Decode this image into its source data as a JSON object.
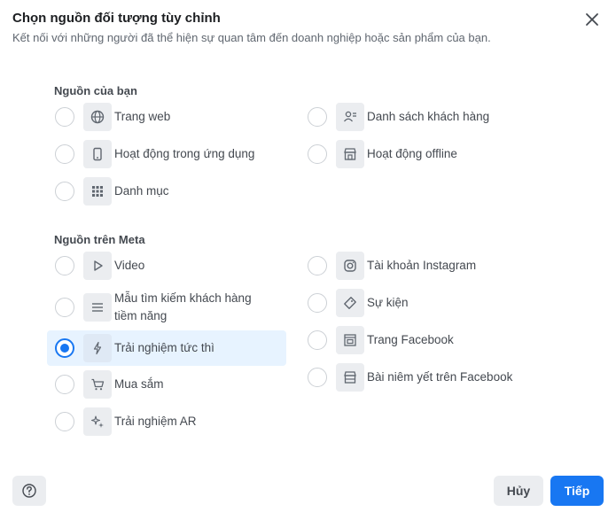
{
  "dialog": {
    "title": "Chọn nguồn đối tượng tùy chỉnh",
    "subtitle": "Kết nối với những người đã thể hiện sự quan tâm đến doanh nghiệp hoặc sản phẩm của bạn."
  },
  "your_sources": {
    "heading": "Nguồn của bạn",
    "options": [
      {
        "label": "Trang web",
        "icon": "globe-icon"
      },
      {
        "label": "Danh sách khách hàng",
        "icon": "customer-list-icon"
      },
      {
        "label": "Hoạt động trong ứng dụng",
        "icon": "mobile-app-icon"
      },
      {
        "label": "Hoạt động offline",
        "icon": "store-icon"
      },
      {
        "label": "Danh mục",
        "icon": "grid-icon"
      }
    ]
  },
  "meta_sources": {
    "heading": "Nguồn trên Meta",
    "options": [
      {
        "label": "Video",
        "icon": "play-icon"
      },
      {
        "label": "Tài khoản Instagram",
        "icon": "instagram-icon"
      },
      {
        "label": "Mẫu tìm kiếm khách hàng tiềm năng",
        "icon": "lines-icon"
      },
      {
        "label": "Sự kiện",
        "icon": "ticket-icon"
      },
      {
        "label": "Trải nghiệm tức thì",
        "icon": "bolt-icon",
        "selected": true
      },
      {
        "label": "Trang Facebook",
        "icon": "page-icon"
      },
      {
        "label": "Mua sắm",
        "icon": "cart-icon"
      },
      {
        "label": "Bài niêm yết trên Facebook",
        "icon": "marketplace-icon"
      },
      {
        "label": "Trải nghiệm AR",
        "icon": "ar-sparkle-icon"
      }
    ]
  },
  "footer": {
    "cancel_label": "Hủy",
    "next_label": "Tiếp"
  },
  "colors": {
    "accent": "#1877f2",
    "selected_bg": "#e7f3ff"
  }
}
